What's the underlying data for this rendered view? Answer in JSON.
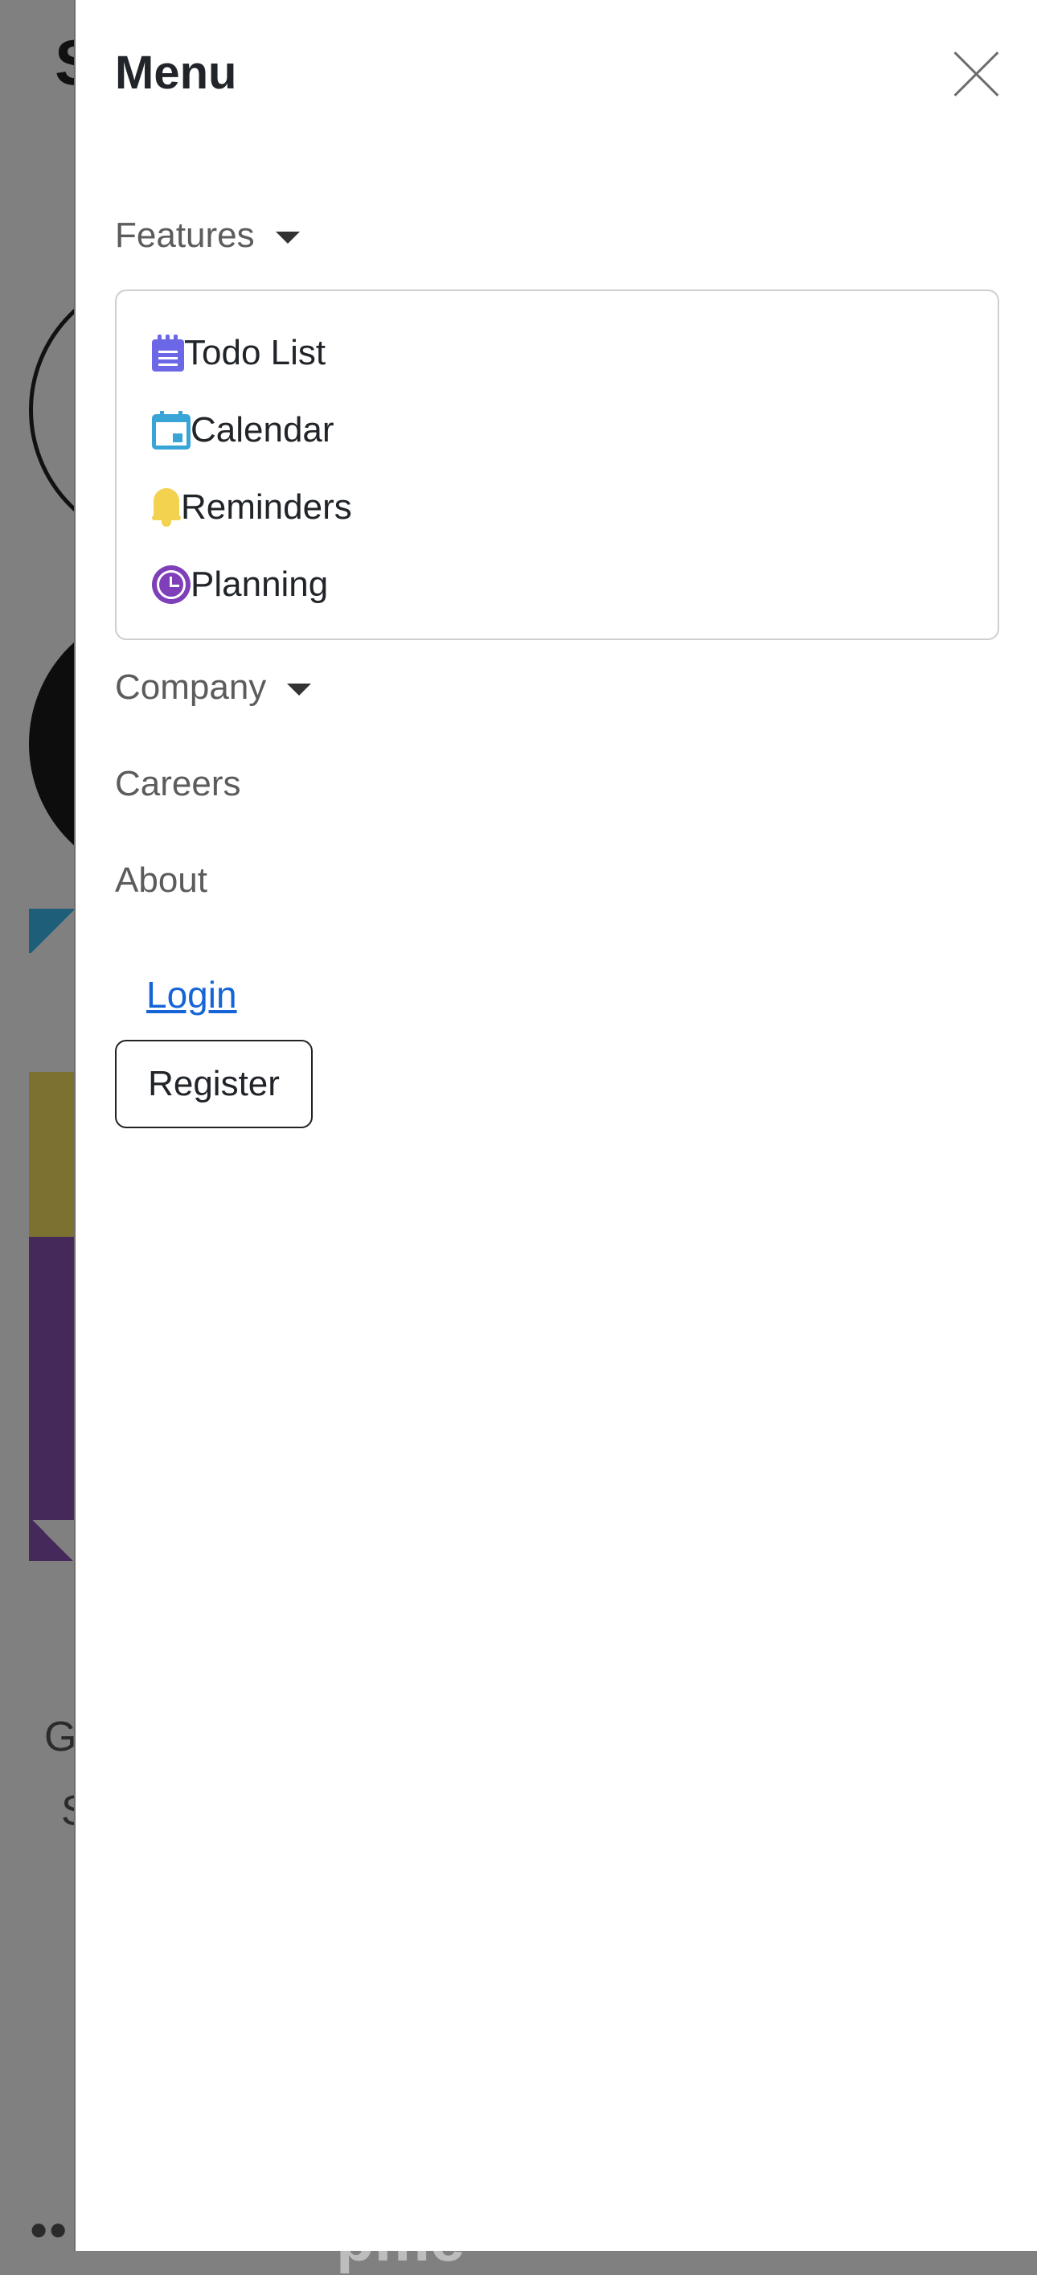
{
  "background": {
    "logo_fragment": "S",
    "text_fragment_1": "G",
    "text_fragment_2": "S",
    "bottom_fragment": "●●",
    "bottom_word": "pme"
  },
  "offcanvas": {
    "title": "Menu",
    "close_icon": "close-icon",
    "nav": {
      "features_label": "Features",
      "features_items": [
        {
          "label": "Todo List",
          "icon": "todo-list-icon",
          "color": "#6b67e6"
        },
        {
          "label": "Calendar",
          "icon": "calendar-icon",
          "color": "#39a4d6"
        },
        {
          "label": "Reminders",
          "icon": "bell-icon",
          "color": "#f2d24e"
        },
        {
          "label": "Planning",
          "icon": "clock-icon",
          "color": "#7e3fb8"
        }
      ],
      "company_label": "Company",
      "careers_label": "Careers",
      "about_label": "About"
    },
    "auth": {
      "login_label": "Login",
      "register_label": "Register"
    }
  },
  "colors": {
    "link": "#1565d8",
    "overlay": "#808080"
  }
}
